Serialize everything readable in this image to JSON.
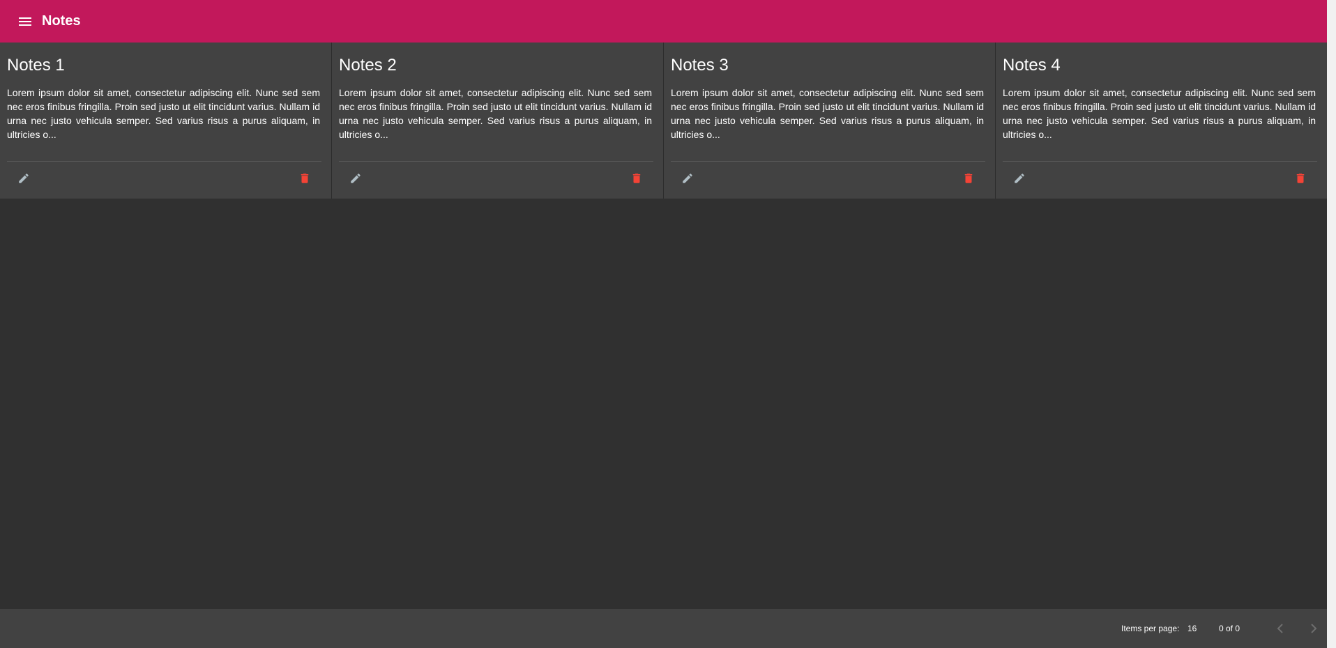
{
  "header": {
    "title": "Notes",
    "menu_icon": "menu-icon",
    "background": "#c2185b"
  },
  "notes": [
    {
      "title": "Notes 1",
      "body": "Lorem ipsum dolor sit amet, consectetur adipiscing elit. Nunc sed sem nec eros finibus fringilla. Proin sed justo ut elit tincidunt varius. Nullam id urna nec justo vehicula semper. Sed varius risus a purus aliquam, in ultricies o..."
    },
    {
      "title": "Notes 2",
      "body": "Lorem ipsum dolor sit amet, consectetur adipiscing elit. Nunc sed sem nec eros finibus fringilla. Proin sed justo ut elit tincidunt varius. Nullam id urna nec justo vehicula semper. Sed varius risus a purus aliquam, in ultricies o..."
    },
    {
      "title": "Notes 3",
      "body": "Lorem ipsum dolor sit amet, consectetur adipiscing elit. Nunc sed sem nec eros finibus fringilla. Proin sed justo ut elit tincidunt varius. Nullam id urna nec justo vehicula semper. Sed varius risus a purus aliquam, in ultricies o..."
    },
    {
      "title": "Notes 4",
      "body": "Lorem ipsum dolor sit amet, consectetur adipiscing elit. Nunc sed sem nec eros finibus fringilla. Proin sed justo ut elit tincidunt varius. Nullam id urna nec justo vehicula semper. Sed varius risus a purus aliquam, in ultricies o..."
    }
  ],
  "card_actions": {
    "edit_icon": "pencil-icon",
    "delete_icon": "trash-icon",
    "edit_color": "#b0bec5",
    "delete_color": "#f44336"
  },
  "paginator": {
    "items_per_page_label": "Items per page:",
    "page_size": "16",
    "range_label": "0 of 0",
    "prev_icon": "chevron-left-icon",
    "next_icon": "chevron-right-icon"
  },
  "theme": {
    "background": "#303030",
    "card_background": "#424242"
  }
}
